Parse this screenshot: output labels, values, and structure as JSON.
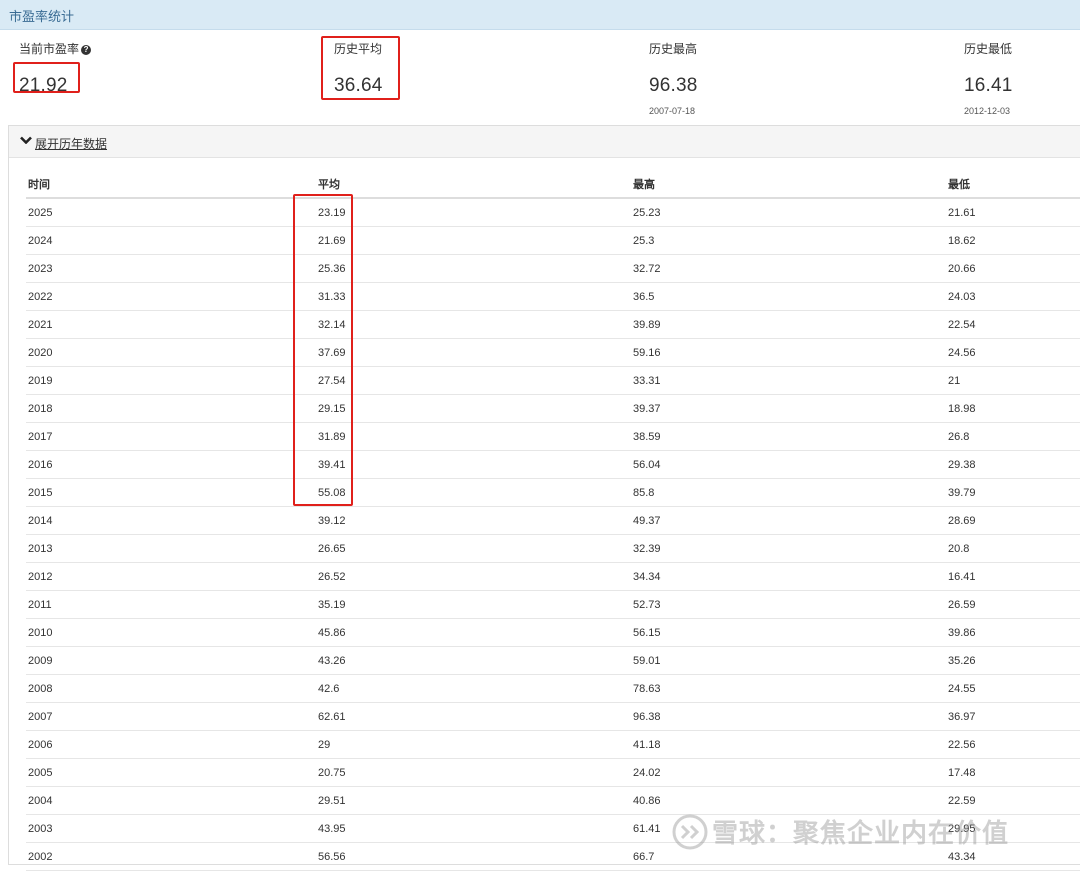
{
  "header": {
    "title": "市盈率统计"
  },
  "stats": [
    {
      "label": "当前市盈率",
      "value": "21.92",
      "date": "",
      "has_help": true
    },
    {
      "label": "历史平均",
      "value": "36.64",
      "date": ""
    },
    {
      "label": "历史最高",
      "value": "96.38",
      "date": "2007-07-18"
    },
    {
      "label": "历史最低",
      "value": "16.41",
      "date": "2012-12-03"
    }
  ],
  "icons": {
    "help": "question-circle-icon",
    "toggle": "chevron-down-icon",
    "watermark": "xueqiu-logo-icon"
  },
  "panel": {
    "toggle_label": "展开历年数据"
  },
  "table": {
    "columns": [
      "时间",
      "平均",
      "最高",
      "最低"
    ],
    "rows": [
      [
        "2025",
        "23.19",
        "25.23",
        "21.61"
      ],
      [
        "2024",
        "21.69",
        "25.3",
        "18.62"
      ],
      [
        "2023",
        "25.36",
        "32.72",
        "20.66"
      ],
      [
        "2022",
        "31.33",
        "36.5",
        "24.03"
      ],
      [
        "2021",
        "32.14",
        "39.89",
        "22.54"
      ],
      [
        "2020",
        "37.69",
        "59.16",
        "24.56"
      ],
      [
        "2019",
        "27.54",
        "33.31",
        "21"
      ],
      [
        "2018",
        "29.15",
        "39.37",
        "18.98"
      ],
      [
        "2017",
        "31.89",
        "38.59",
        "26.8"
      ],
      [
        "2016",
        "39.41",
        "56.04",
        "29.38"
      ],
      [
        "2015",
        "55.08",
        "85.8",
        "39.79"
      ],
      [
        "2014",
        "39.12",
        "49.37",
        "28.69"
      ],
      [
        "2013",
        "26.65",
        "32.39",
        "20.8"
      ],
      [
        "2012",
        "26.52",
        "34.34",
        "16.41"
      ],
      [
        "2011",
        "35.19",
        "52.73",
        "26.59"
      ],
      [
        "2010",
        "45.86",
        "56.15",
        "39.86"
      ],
      [
        "2009",
        "43.26",
        "59.01",
        "35.26"
      ],
      [
        "2008",
        "42.6",
        "78.63",
        "24.55"
      ],
      [
        "2007",
        "62.61",
        "96.38",
        "36.97"
      ],
      [
        "2006",
        "29",
        "41.18",
        "22.56"
      ],
      [
        "2005",
        "20.75",
        "24.02",
        "17.48"
      ],
      [
        "2004",
        "29.51",
        "40.86",
        "22.59"
      ],
      [
        "2003",
        "43.95",
        "61.41",
        "29.95"
      ],
      [
        "2002",
        "56.56",
        "66.7",
        "43.34"
      ]
    ]
  },
  "watermark": {
    "text": "雪球：聚焦企业内在价值"
  },
  "colors": {
    "highlight": "#e0201b",
    "header_bg": "#d9eaf5",
    "title": "#3a6c94"
  }
}
